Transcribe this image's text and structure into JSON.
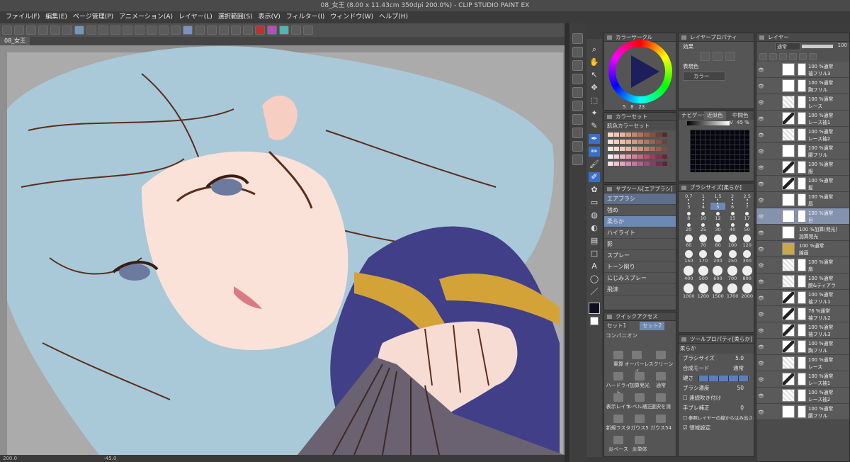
{
  "window": {
    "title": "08_女王 (8.00 x 11.43cm 350dpi 200.0%) - CLIP STUDIO PAINT EX"
  },
  "menu": [
    "ファイル(F)",
    "編集(E)",
    "ページ管理(P)",
    "アニメーション(A)",
    "レイヤー(L)",
    "選択範囲(S)",
    "表示(V)",
    "フィルター(I)",
    "ウィンドウ(W)",
    "ヘルプ(H)"
  ],
  "document_tab": "08_女王",
  "status": {
    "zoom": "200.0",
    "angle": "-45.0"
  },
  "color_panel": {
    "title": "カラーサークル",
    "hsv": [
      "5",
      "8",
      "23"
    ]
  },
  "color_set": {
    "title": "カラーセット",
    "set_name": "肌色カラーセット",
    "swatches": [
      "#f6d9c8",
      "#f1c6ae",
      "#e8b49a",
      "#d99b80",
      "#c98469",
      "#b8705a",
      "#a15e4c",
      "#8a4e41",
      "#6e3f35",
      "#4f2e28",
      "#f8e3d6",
      "#f3d1bf",
      "#ecc0a9",
      "#e2ae95",
      "#d49c84",
      "#c48873",
      "#b07562",
      "#9a6354",
      "#815247",
      "#69443c",
      "#fbe8df",
      "#f5d9cb",
      "#efc9b6",
      "#e6b7a1",
      "#dba58d",
      "#ce937b",
      "#bd8069",
      "#aa6e58",
      "#955d4a",
      "#7d4e3f",
      "#ffeef0",
      "#f6d0d6",
      "#eeb5c0",
      "#e599a8",
      "#da7f92",
      "#cc667d",
      "#b84e69",
      "#a13c58",
      "#883049",
      "#6b253a",
      "#f7dfe8",
      "#ecc2d6",
      "#e1a6c4",
      "#d48bb2",
      "#c774a0",
      "#b55f8e",
      "#a04c7b",
      "#883c67",
      "#6f2f53",
      "#57263f"
    ]
  },
  "subtool": {
    "title": "サブツール[エアブラシ]",
    "header": "エアブラシ",
    "items": [
      "強め",
      "柔らか",
      "ハイライト",
      "影",
      "スプレー",
      "トーン削り",
      "にじみスプレー",
      "飛沫"
    ],
    "selected": 1
  },
  "quick_access": {
    "title": "クイックアクセス",
    "tabs": [
      "セット1",
      "セット2"
    ],
    "combo": "コンバニオン",
    "buttons": [
      "乗算",
      "オーバーレイ",
      "スクリーン",
      "ハードライト",
      "加算発光",
      "通常",
      "表示レイヤ",
      "レベル補正",
      "選択を消",
      "新規ラスタ",
      "ガウス5",
      "ガウス54",
      "炎ベース",
      "炎単体"
    ]
  },
  "layer_property": {
    "title": "レイヤープロパティ",
    "effect_label": "効果",
    "color_label": "表現色",
    "color_value": "カラー"
  },
  "navigator": {
    "tabs": [
      "ナビゲーター",
      "近似色",
      "中間色"
    ],
    "value_label": "V",
    "value": "45 %"
  },
  "brush_size": {
    "title": "ブラシサイズ[柔らか]",
    "sizes": [
      "0.7",
      "1",
      "1.5",
      "2",
      "2.5",
      "3",
      "4",
      "5",
      "6",
      "7",
      "8",
      "10",
      "12",
      "15",
      "17",
      "20",
      "25",
      "30",
      "40",
      "50",
      "60",
      "70",
      "80",
      "100",
      "120",
      "150",
      "170",
      "200",
      "250",
      "300",
      "400",
      "500",
      "600",
      "700",
      "800",
      "1000",
      "1200",
      "1500",
      "1700",
      "2000"
    ],
    "selected": "5"
  },
  "tool_property": {
    "title": "ツールプロパティ[柔らか]",
    "header": "柔らか",
    "brush_size_label": "ブラシサイズ",
    "brush_size_value": "5.0",
    "blend_label": "合成モード",
    "blend_value": "通常",
    "hardness_label": "硬さ",
    "density_label": "ブラシ濃度",
    "density_value": "50",
    "check1": "連続吹き付け",
    "stabilization_label": "手ブレ補正",
    "stabilization_value": "0",
    "check2": "参照レイヤーの線からはみ出さない",
    "check3": "領域設定"
  },
  "layer_panel": {
    "title": "レイヤー",
    "blend": "通常",
    "opacity": "100",
    "layers": [
      {
        "meta": "100 %通常",
        "name": "袖フリル3",
        "thumb": "plain"
      },
      {
        "meta": "100 %通常",
        "name": "胸フリル",
        "thumb": "plain"
      },
      {
        "meta": "100 %通常",
        "name": "レース",
        "thumb": "lace"
      },
      {
        "meta": "100 %通常",
        "name": "レース袖1",
        "thumb": "dark"
      },
      {
        "meta": "100 %通常",
        "name": "レース袖2",
        "thumb": "lace"
      },
      {
        "meta": "100 %通常",
        "name": "腰フリル",
        "thumb": "plain"
      },
      {
        "meta": "100 %通常",
        "name": "服",
        "thumb": "dark"
      },
      {
        "meta": "100 %通常",
        "name": "髪",
        "thumb": "dark"
      },
      {
        "meta": "100 %通常",
        "name": "唇",
        "thumb": "plain"
      },
      {
        "meta": "100 %通常",
        "name": "目",
        "thumb": "plain",
        "selected": true
      },
      {
        "meta": "100 %加算(発光)",
        "name": "加算発光",
        "thumb": "plain",
        "folder": true
      },
      {
        "meta": "100 %通常",
        "name": "線画",
        "thumb": "folder",
        "folder": true
      },
      {
        "meta": "100 %通常",
        "name": "扇",
        "thumb": "lace"
      },
      {
        "meta": "100 %通常",
        "name": "腕&ティアラ",
        "thumb": "lace"
      },
      {
        "meta": "100 %通常",
        "name": "袖フリル1",
        "thumb": "dark"
      },
      {
        "meta": "76 %通常",
        "name": "袖フリル2",
        "thumb": "dark"
      },
      {
        "meta": "100 %通常",
        "name": "袖フリル3",
        "thumb": "dark"
      },
      {
        "meta": "100 %通常",
        "name": "胸フリル",
        "thumb": "dark"
      },
      {
        "meta": "100 %通常",
        "name": "レース",
        "thumb": "lace"
      },
      {
        "meta": "100 %通常",
        "name": "レース袖1",
        "thumb": "dark"
      },
      {
        "meta": "100 %通常",
        "name": "レース袖2",
        "thumb": "lace"
      },
      {
        "meta": "100 %通常",
        "name": "腰フリル",
        "thumb": "plain"
      }
    ]
  }
}
